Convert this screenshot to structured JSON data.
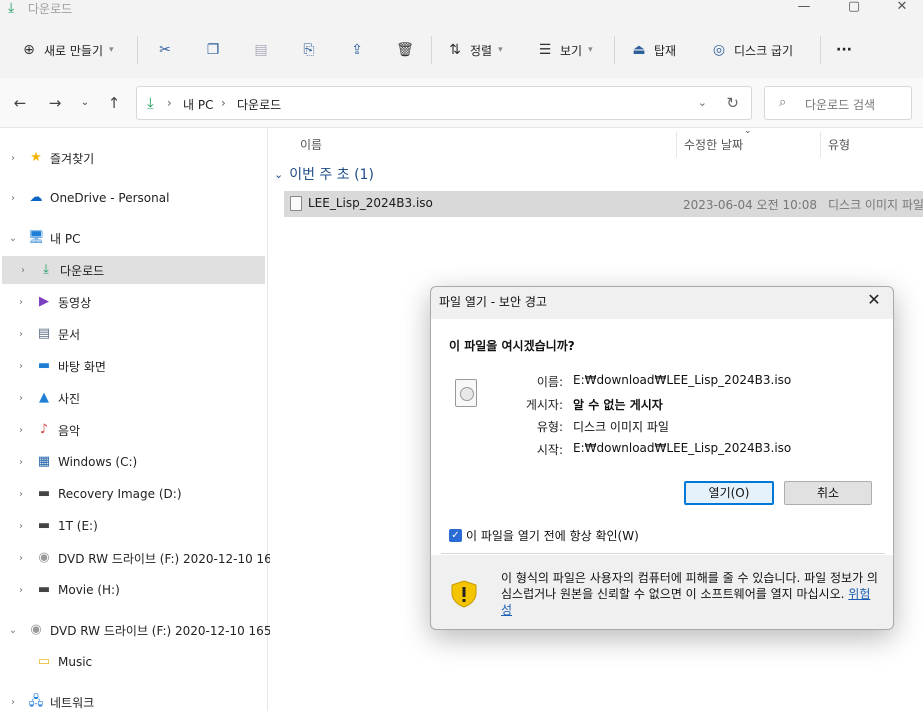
{
  "window": {
    "title": "다운로드",
    "icon": "download-icon",
    "controls": [
      "minimize",
      "maximize",
      "close"
    ]
  },
  "toolbar": {
    "new_label": "새로 만들기",
    "sort_label": "정렬",
    "view_label": "보기",
    "mount_label": "탑재",
    "burn_label": "디스크 굽기",
    "more_label": "···"
  },
  "address": {
    "crumbs": [
      "내 PC",
      "다운로드"
    ],
    "search_placeholder": "다운로드 검색"
  },
  "sidebar": {
    "items": [
      {
        "label": "즐겨찾기",
        "icon": "star-icon"
      },
      {
        "label": "OneDrive - Personal",
        "icon": "cloud-icon"
      },
      {
        "label": "내 PC",
        "icon": "pc-icon"
      },
      {
        "label": "다운로드",
        "icon": "download-icon"
      },
      {
        "label": "동영상",
        "icon": "video-icon"
      },
      {
        "label": "문서",
        "icon": "document-icon"
      },
      {
        "label": "바탕 화면",
        "icon": "desktop-icon"
      },
      {
        "label": "사진",
        "icon": "picture-icon"
      },
      {
        "label": "음악",
        "icon": "music-icon"
      },
      {
        "label": "Windows (C:)",
        "icon": "drive-icon"
      },
      {
        "label": "Recovery Image (D:)",
        "icon": "drive-icon"
      },
      {
        "label": "1T (E:)",
        "icon": "drive-icon"
      },
      {
        "label": "DVD RW 드라이브 (F:) 2020-12-10 16",
        "icon": "dvd-icon"
      },
      {
        "label": "Movie (H:)",
        "icon": "drive-icon"
      },
      {
        "label": "DVD RW 드라이브 (F:) 2020-12-10 165",
        "icon": "dvd-icon"
      },
      {
        "label": "Music",
        "icon": "folder-icon"
      },
      {
        "label": "네트워크",
        "icon": "network-icon"
      }
    ]
  },
  "list": {
    "columns": [
      "이름",
      "수정한 날짜",
      "유형"
    ],
    "group": "이번 주 초 (1)",
    "files": [
      {
        "name": "LEE_Lisp_2024B3.iso",
        "date": "2023-06-04 오전 10:08",
        "type": "디스크 이미지 파일"
      }
    ]
  },
  "dialog": {
    "title": "파일 열기 - 보안 경고",
    "question": "이 파일을 여시겠습니까?",
    "fields": [
      {
        "key": "이름:",
        "value": "E:₩download₩LEE_Lisp_2024B3.iso"
      },
      {
        "key": "게시자:",
        "value": "알 수 없는 게시자"
      },
      {
        "key": "유형:",
        "value": "디스크 이미지 파일"
      },
      {
        "key": "시작:",
        "value": "E:₩download₩LEE_Lisp_2024B3.iso"
      }
    ],
    "open_label": "열기(O)",
    "cancel_label": "취소",
    "checkbox_label": "이 파일을 열기 전에 항상 확인(W)",
    "checkbox_checked": true,
    "warning_text": "이 형식의 파일은 사용자의 컴퓨터에 피해를 줄 수 있습니다. 파일 정보가 의심스럽거나 원본을 신뢰할 수 없으면 이 소프트웨어를 열지 마십시오.",
    "warning_link": "위험성"
  }
}
